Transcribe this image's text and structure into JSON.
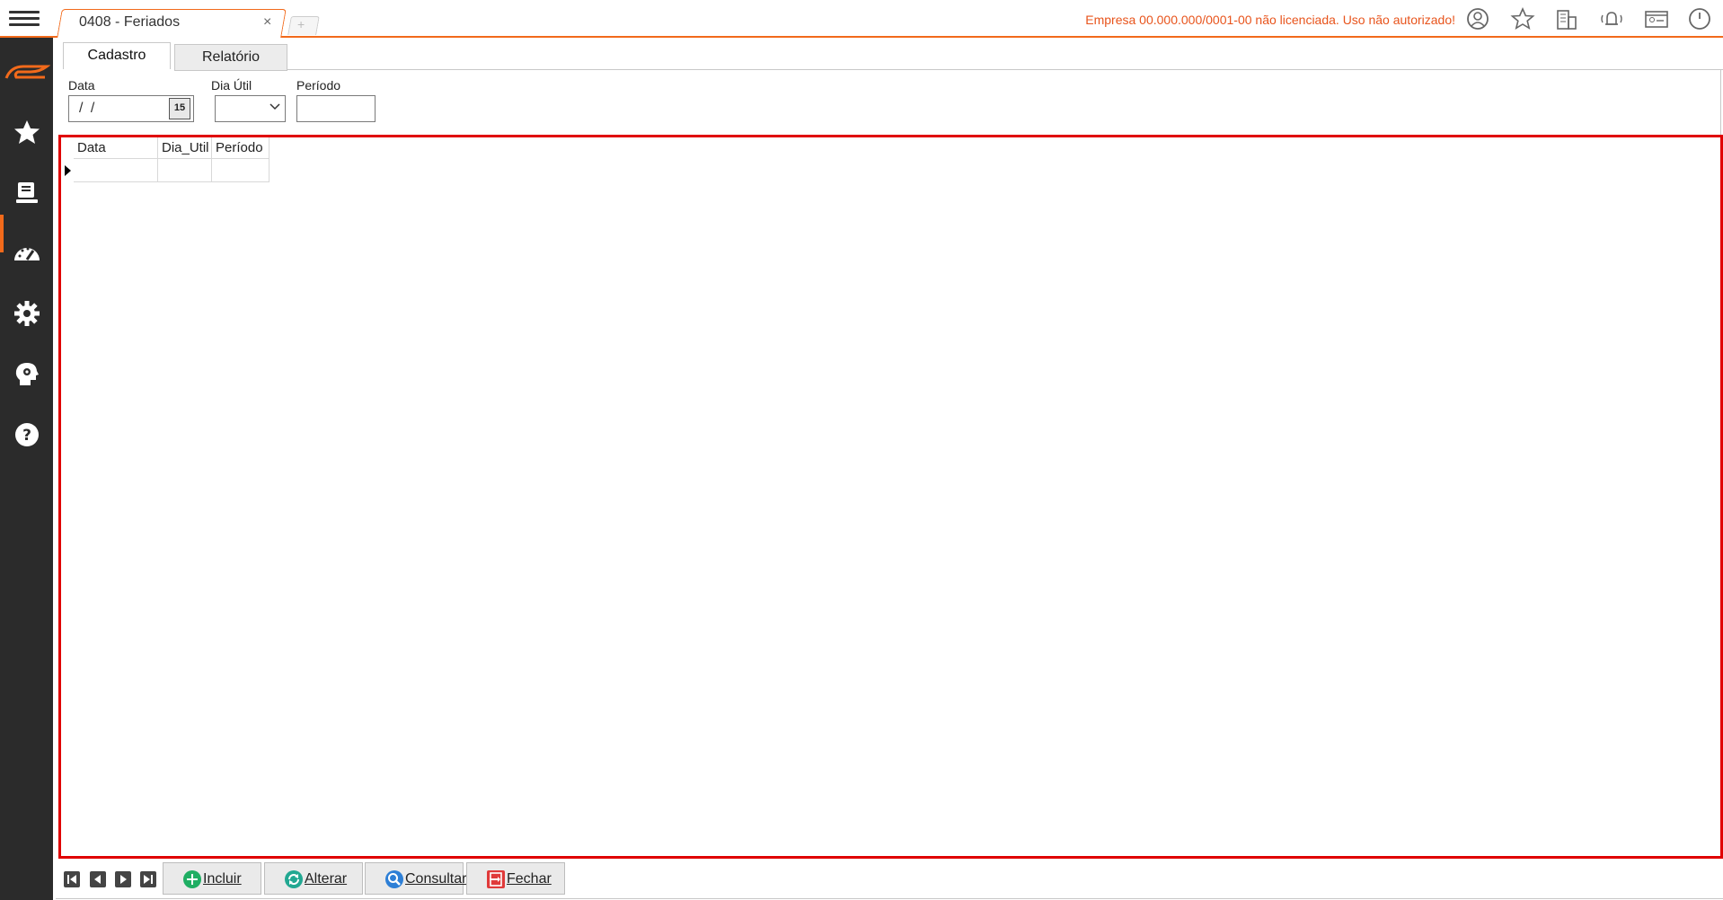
{
  "window": {
    "tab_title": "0408 - Feriados",
    "tab_close": "×",
    "new_tab": "+"
  },
  "license_warning": "Empresa 00.000.000/0001-00 não licenciada. Uso não autorizado!",
  "top_icons": [
    "user-circle-icon",
    "star-outline-icon",
    "buildings-icon",
    "bell-ring-icon",
    "id-card-icon",
    "power-icon"
  ],
  "sidebar": {
    "items": [
      "logo-icon",
      "favorites-star-icon",
      "registry-icon",
      "dashboard-gauge-icon",
      "settings-gear-icon",
      "support-head-gear-icon",
      "help-question-icon"
    ],
    "active": "registry-icon"
  },
  "form": {
    "tabs": [
      {
        "label": "Cadastro",
        "active": true
      },
      {
        "label": "Relatório",
        "active": false
      }
    ],
    "fields": {
      "data_label": "Data",
      "data_value": "/ /",
      "calendar_button": "15",
      "dia_util_label": "Dia Útil",
      "dia_util_value": "",
      "periodo_label": "Período",
      "periodo_value": ""
    }
  },
  "grid": {
    "columns": [
      "Data",
      "Dia_Util",
      "Período"
    ],
    "rows": []
  },
  "toolbar": {
    "nav": [
      "first-record-icon",
      "previous-record-icon",
      "next-record-icon",
      "last-record-icon"
    ],
    "incluir": "Incluir",
    "alterar": "Alterar",
    "consultar": "Consultar",
    "fechar": "Fechar"
  },
  "colors": {
    "accent": "#f26a1b",
    "sidebar": "#2b2b2b",
    "grid_highlight": "#e00000",
    "license_text": "#e8541c"
  }
}
